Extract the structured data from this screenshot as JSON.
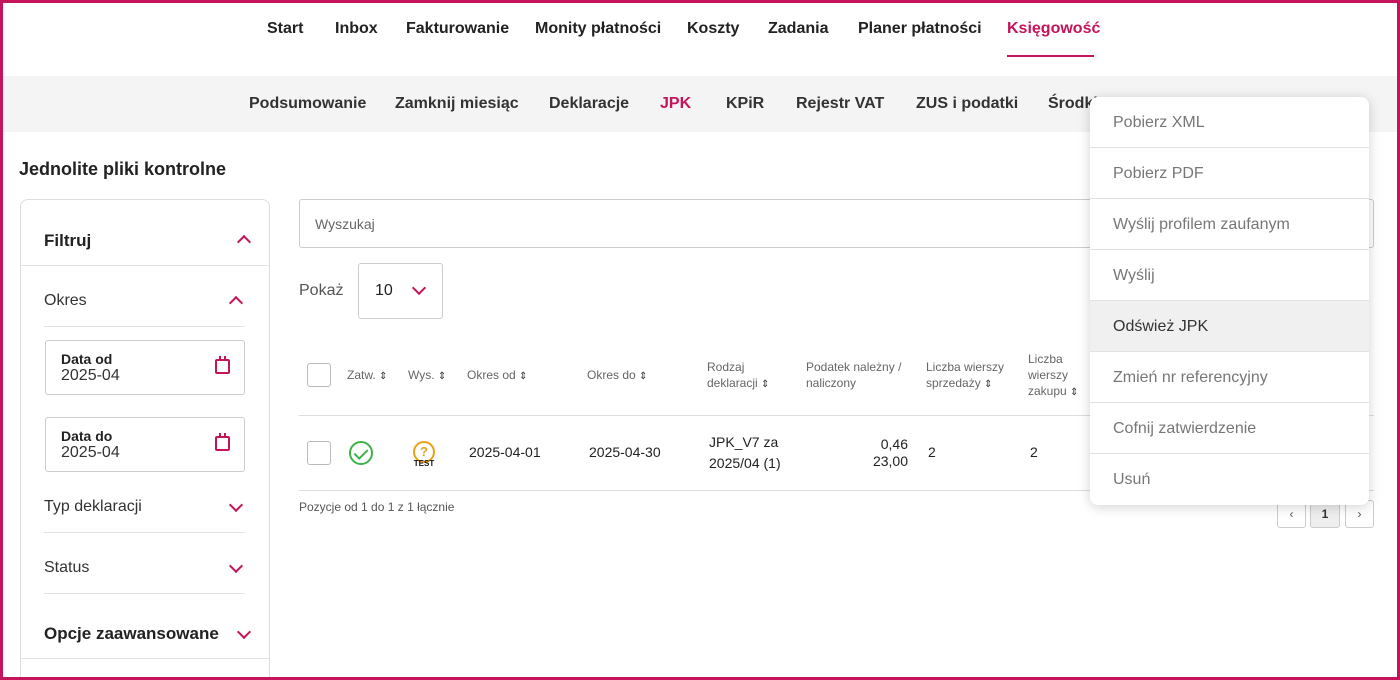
{
  "top_nav": {
    "items": [
      "Start",
      "Inbox",
      "Fakturowanie",
      "Monity płatności",
      "Koszty",
      "Zadania",
      "Planer płatności",
      "Księgowość"
    ],
    "active": "Księgowość"
  },
  "sub_nav": {
    "items": [
      "Podsumowanie",
      "Zamknij miesiąc",
      "Deklaracje",
      "JPK",
      "KPiR",
      "Rejestr VAT",
      "ZUS i podatki",
      "Środki"
    ],
    "active": "JPK"
  },
  "page_title": "Jednolite pliki kontrolne",
  "filter": {
    "title": "Filtruj",
    "period_label": "Okres",
    "date_from_label": "Data od",
    "date_from_value": "2025-04",
    "date_to_label": "Data do",
    "date_to_value": "2025-04",
    "declaration_type_label": "Typ deklaracji",
    "status_label": "Status",
    "advanced_label": "Opcje zaawansowane"
  },
  "search": {
    "placeholder": "Wyszukaj"
  },
  "page_size": {
    "label": "Pokaż",
    "value": "10"
  },
  "table": {
    "headers": {
      "approved": "Zatw.",
      "sent": "Wys.",
      "period_from": "Okres od",
      "period_to": "Okres do",
      "decl_type_1": "Rodzaj",
      "decl_type_2": "deklaracji",
      "tax_1": "Podatek należny /",
      "tax_2": "naliczony",
      "sales_rows_1": "Liczba wierszy",
      "sales_rows_2": "sprzedaży",
      "purchase_rows_1": "Liczba",
      "purchase_rows_2": "wierszy",
      "purchase_rows_3": "zakupu"
    },
    "sort_glyph": "⇕",
    "rows": [
      {
        "period_from": "2025-04-01",
        "period_to": "2025-04-30",
        "decl_type_1": "JPK_V7 za",
        "decl_type_2": "2025/04 (1)",
        "tax_due": "0,46",
        "tax_input": "23,00",
        "sales_rows": "2",
        "purchase_rows": "2",
        "approved_icon": "check-circle-icon",
        "sent_icon": "test-question-icon",
        "sent_badge": "TEST"
      }
    ],
    "summary": "Pozycje od 1 do 1 z 1 łącznie"
  },
  "pagination": {
    "prev": "‹",
    "current": "1",
    "next": "›"
  },
  "context_menu": {
    "items": [
      "Pobierz XML",
      "Pobierz PDF",
      "Wyślij profilem zaufanym",
      "Wyślij",
      "Odśwież JPK",
      "Zmień nr referencyjny",
      "Cofnij zatwierdzenie",
      "Usuń"
    ],
    "highlighted": "Odśwież JPK"
  },
  "colors": {
    "accent": "#c4145a",
    "success": "#3db14a",
    "warning": "#e8a21a"
  }
}
